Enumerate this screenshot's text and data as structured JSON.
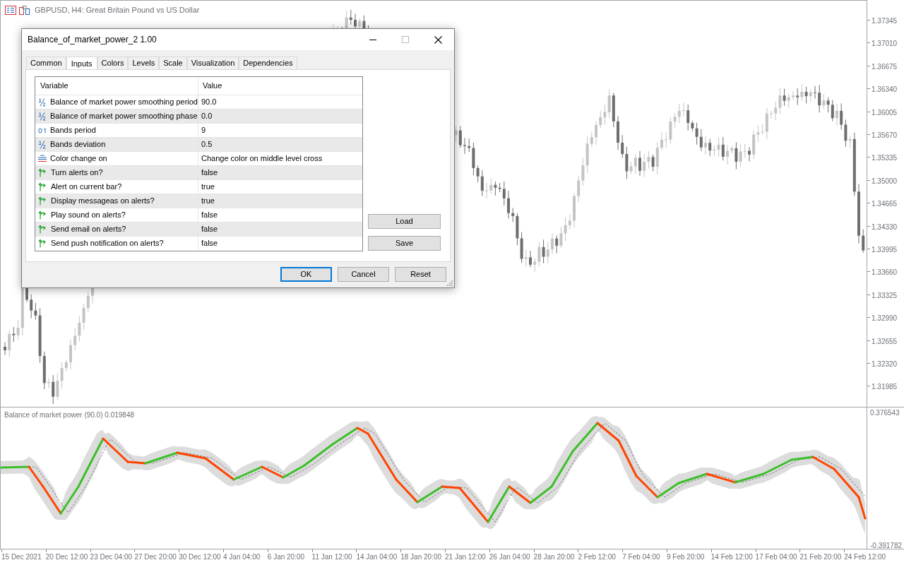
{
  "chart": {
    "title": "GBPUSD, H4: Great Britain Pound vs US Dollar",
    "price_axis": [
      "1.37345",
      "1.37010",
      "1.36675",
      "1.36340",
      "1.36005",
      "1.35670",
      "1.35335",
      "1.35000",
      "1.34665",
      "1.34330",
      "1.33995",
      "1.33660",
      "1.33325",
      "1.32990",
      "1.32655",
      "1.32320",
      "1.31985"
    ]
  },
  "indicator": {
    "label": "Balance of market power (90.0) 0.019848",
    "axis_max": "0.376543",
    "axis_min": "-0.391782"
  },
  "time_axis": [
    "15 Dec 2021",
    "20 Dec 12:00",
    "23 Dec 04:00",
    "27 Dec 20:00",
    "30 Dec 12:00",
    "4 Jan 04:00",
    "6 Jan 20:00",
    "11 Jan 12:00",
    "14 Jan 04:00",
    "18 Jan 20:00",
    "21 Jan 12:00",
    "26 Jan 04:00",
    "28 Jan 20:00",
    "2 Feb 12:00",
    "7 Feb 04:00",
    "9 Feb 20:00",
    "14 Feb 12:00",
    "17 Feb 04:00",
    "21 Feb 20:00",
    "24 Feb 12:00"
  ],
  "dialog": {
    "title": "Balance_of_market_power_2 1.00",
    "tabs": [
      {
        "label": "Common",
        "selected": false
      },
      {
        "label": "Inputs",
        "selected": true
      },
      {
        "label": "Colors",
        "selected": false
      },
      {
        "label": "Levels",
        "selected": false
      },
      {
        "label": "Scale",
        "selected": false
      },
      {
        "label": "Visualization",
        "selected": false
      },
      {
        "label": "Dependencies",
        "selected": false
      }
    ],
    "table": {
      "columns": [
        "Variable",
        "Value"
      ],
      "rows": [
        {
          "kind": "double",
          "variable": "Balance of market power smoothing period",
          "value": "90.0"
        },
        {
          "kind": "double",
          "variable": "Balance of market power smoothing phase",
          "value": "0.0"
        },
        {
          "kind": "int",
          "variable": "Bands period",
          "value": "9"
        },
        {
          "kind": "double",
          "variable": "Bands deviation",
          "value": "0.5"
        },
        {
          "kind": "enum",
          "variable": "Color change on",
          "value": "Change color on middle level cross"
        },
        {
          "kind": "bool",
          "variable": "Turn alerts on?",
          "value": "false"
        },
        {
          "kind": "bool",
          "variable": "Alert on current bar?",
          "value": "true"
        },
        {
          "kind": "bool",
          "variable": "Display messageas on alerts?",
          "value": "true"
        },
        {
          "kind": "bool",
          "variable": "Play sound on alerts?",
          "value": "false"
        },
        {
          "kind": "bool",
          "variable": "Send email on alerts?",
          "value": "false"
        },
        {
          "kind": "bool",
          "variable": "Send push notification on alerts?",
          "value": "false"
        }
      ]
    },
    "side_buttons": [
      "Load",
      "Save"
    ],
    "buttons": [
      {
        "label": "OK",
        "default": true
      },
      {
        "label": "Cancel",
        "default": false
      },
      {
        "label": "Reset",
        "default": false
      }
    ]
  }
}
